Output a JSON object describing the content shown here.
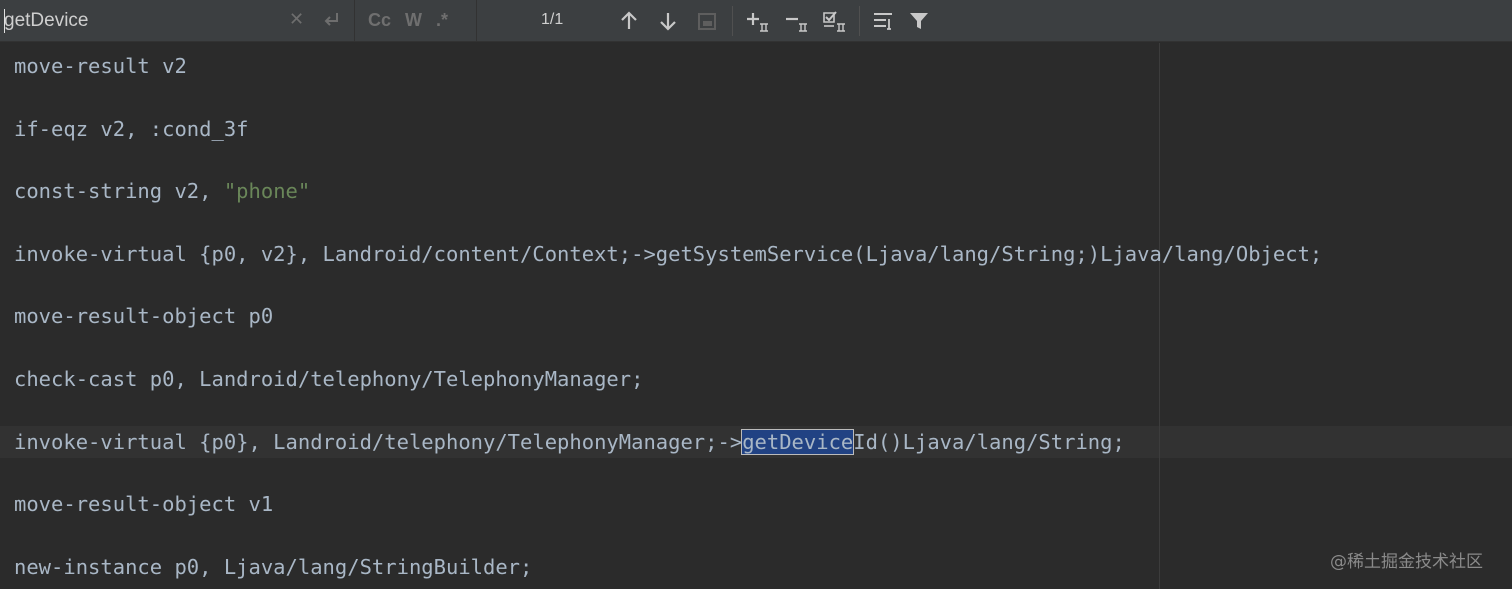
{
  "find": {
    "query": "getDevice",
    "clear_glyph": "✕",
    "options": [
      "Cc",
      "W",
      ".*"
    ],
    "match_count": "1/1"
  },
  "icons": {
    "clear": "close-icon",
    "newline": "newline-icon",
    "prev": "arrow-up-icon",
    "next": "arrow-down-icon",
    "select_all": "select-all-occurrences-icon",
    "add_selection": "add-selection-icon",
    "remove_selection": "remove-selection-icon",
    "select_all_occurrences": "select-all-occurrences-checkbox-icon",
    "filter_settings": "filter-settings-icon",
    "filter": "filter-icon"
  },
  "code": {
    "l1": "move-result v2",
    "l2": "if-eqz v2, :cond_3f",
    "l3_pre": "const-string v2, ",
    "l3_str": "\"phone\"",
    "l4": "invoke-virtual {p0, v2}, Landroid/content/Context;->getSystemService(Ljava/lang/String;)Ljava/lang/Object;",
    "l5": "move-result-object p0",
    "l6": "check-cast p0, Landroid/telephony/TelephonyManager;",
    "l7_pre": "invoke-virtual {p0}, Landroid/telephony/TelephonyManager;->",
    "l7_match": "getDevice",
    "l7_post": "Id()Ljava/lang/String;",
    "l8": "move-result-object v1",
    "l9": "new-instance p0, Ljava/lang/StringBuilder;"
  },
  "colors": {
    "background": "#2b2b2b",
    "toolbar": "#3c3f41",
    "code_text": "#a9b7c6",
    "string_literal": "#6a8759",
    "match_highlight": "#214283"
  },
  "watermark": "@稀土掘金技术社区"
}
